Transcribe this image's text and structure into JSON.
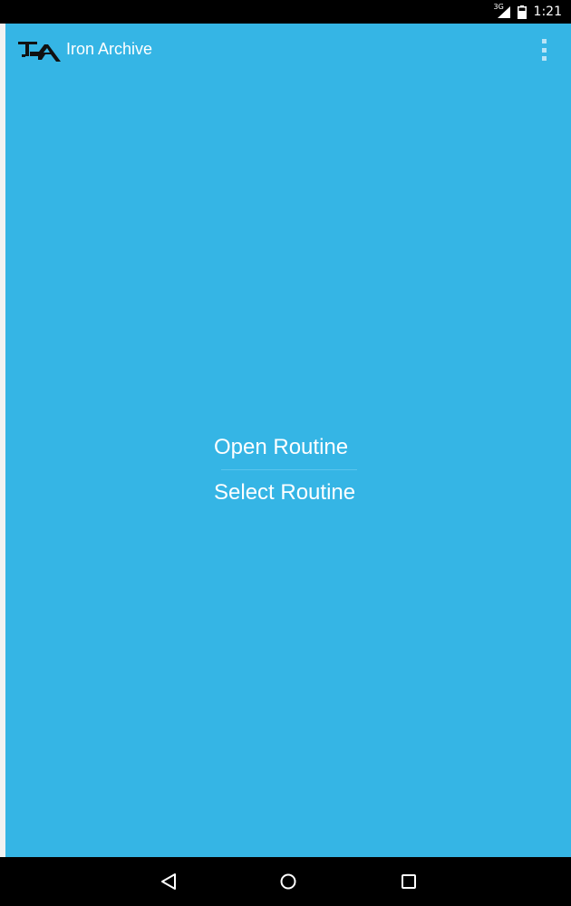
{
  "status_bar": {
    "network_type": "3G",
    "time": "1:21",
    "icons": [
      "signal-icon",
      "battery-icon"
    ]
  },
  "toolbar": {
    "app_title": "Iron Archive",
    "logo_icon": "iron-archive-logo-icon",
    "overflow_icon": "more-vert-icon"
  },
  "main": {
    "items": [
      {
        "label": "Open Routine"
      },
      {
        "label": "Select Routine"
      }
    ]
  },
  "nav_bar": {
    "buttons": [
      "back-icon",
      "home-icon",
      "recents-icon"
    ]
  },
  "colors": {
    "app_background": "#35b5e5",
    "bars": "#000000",
    "text": "#ffffff"
  }
}
